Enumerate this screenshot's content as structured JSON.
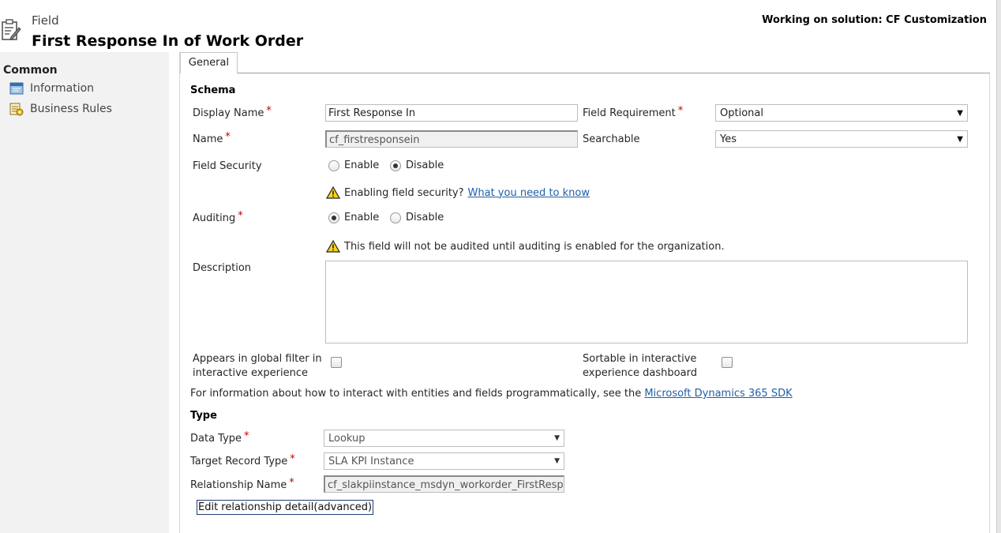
{
  "header": {
    "entity": "Field",
    "title": "First Response In of Work Order",
    "solution": "Working on solution: CF Customization"
  },
  "nav": {
    "heading": "Common",
    "items": [
      {
        "label": "Information",
        "icon": "information-icon"
      },
      {
        "label": "Business Rules",
        "icon": "business-rules-icon"
      }
    ]
  },
  "tabs": [
    {
      "label": "General"
    }
  ],
  "schema": {
    "title": "Schema",
    "display_name_label": "Display Name",
    "display_name_value": "First Response In",
    "name_label": "Name",
    "name_value": "cf_firstresponsein",
    "field_requirement_label": "Field Requirement",
    "field_requirement_value": "Optional",
    "searchable_label": "Searchable",
    "searchable_value": "Yes",
    "field_security_label": "Field Security",
    "field_security_options": [
      "Enable",
      "Disable"
    ],
    "field_security_selected": "Disable",
    "security_warning_text": "Enabling field security?",
    "security_warning_link": "What you need to know",
    "auditing_label": "Auditing",
    "auditing_options": [
      "Enable",
      "Disable"
    ],
    "auditing_selected": "Enable",
    "auditing_warning_text": "This field will not be audited until auditing is enabled for the organization.",
    "description_label": "Description",
    "description_value": "",
    "global_filter_label_1": "Appears in global filter in",
    "global_filter_label_2": "interactive experience",
    "sortable_label_1": "Sortable in interactive",
    "sortable_label_2": "experience dashboard",
    "sdk_text": "For information about how to interact with entities and fields programmatically, see the",
    "sdk_link": "Microsoft Dynamics 365 SDK"
  },
  "type": {
    "title": "Type",
    "data_type_label": "Data Type",
    "data_type_value": "Lookup",
    "target_record_type_label": "Target Record Type",
    "target_record_type_value": "SLA KPI Instance",
    "relationship_name_label": "Relationship Name",
    "relationship_name_value": "cf_slakpiinstance_msdyn_workorder_FirstResponse",
    "edit_relationship_label": "Edit relationship detail(advanced)"
  },
  "colors": {
    "required": "#c00000",
    "link": "#1f5fa8",
    "nav_background": "#f2f2f2"
  }
}
